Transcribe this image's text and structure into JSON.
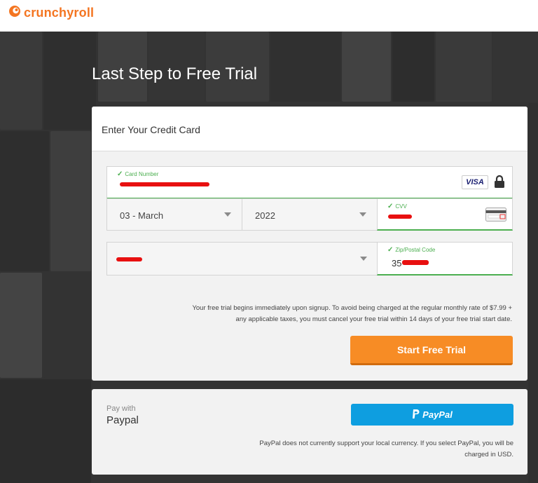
{
  "brand": {
    "name": "crunchyroll",
    "color": "#f47521"
  },
  "page": {
    "title": "Last Step to Free Trial"
  },
  "credit_card": {
    "header": "Enter Your Credit Card",
    "card_number_label": "Card Number",
    "card_brand": "VISA",
    "month_value": "03 - March",
    "year_value": "2022",
    "cvv_label": "CVV",
    "country_value": "",
    "zip_label": "Zip/Postal Code",
    "zip_value": "35",
    "notice_line1": "Your free trial begins immediately upon signup. To avoid being charged at the regular monthly rate of $7.99 +",
    "notice_line2": "any applicable taxes, you must cancel your free trial within 14 days of your free trial start date.",
    "submit_label": "Start Free Trial"
  },
  "paypal": {
    "pay_with": "Pay with",
    "method": "Paypal",
    "button_label": "PayPal",
    "note_line1": "PayPal does not currently support your local currency. If you select PayPal, you will be",
    "note_line2": "charged in USD."
  },
  "icons": {
    "logo": "crunchyroll-logo-icon",
    "lock": "lock-icon",
    "cvv_card": "cvv-card-icon",
    "check": "checkmark-icon",
    "dropdown": "chevron-down-icon",
    "paypal": "paypal-p-icon"
  },
  "colors": {
    "accent": "#f78c25",
    "valid": "#4caf50",
    "paypal": "#0e9ee0"
  }
}
